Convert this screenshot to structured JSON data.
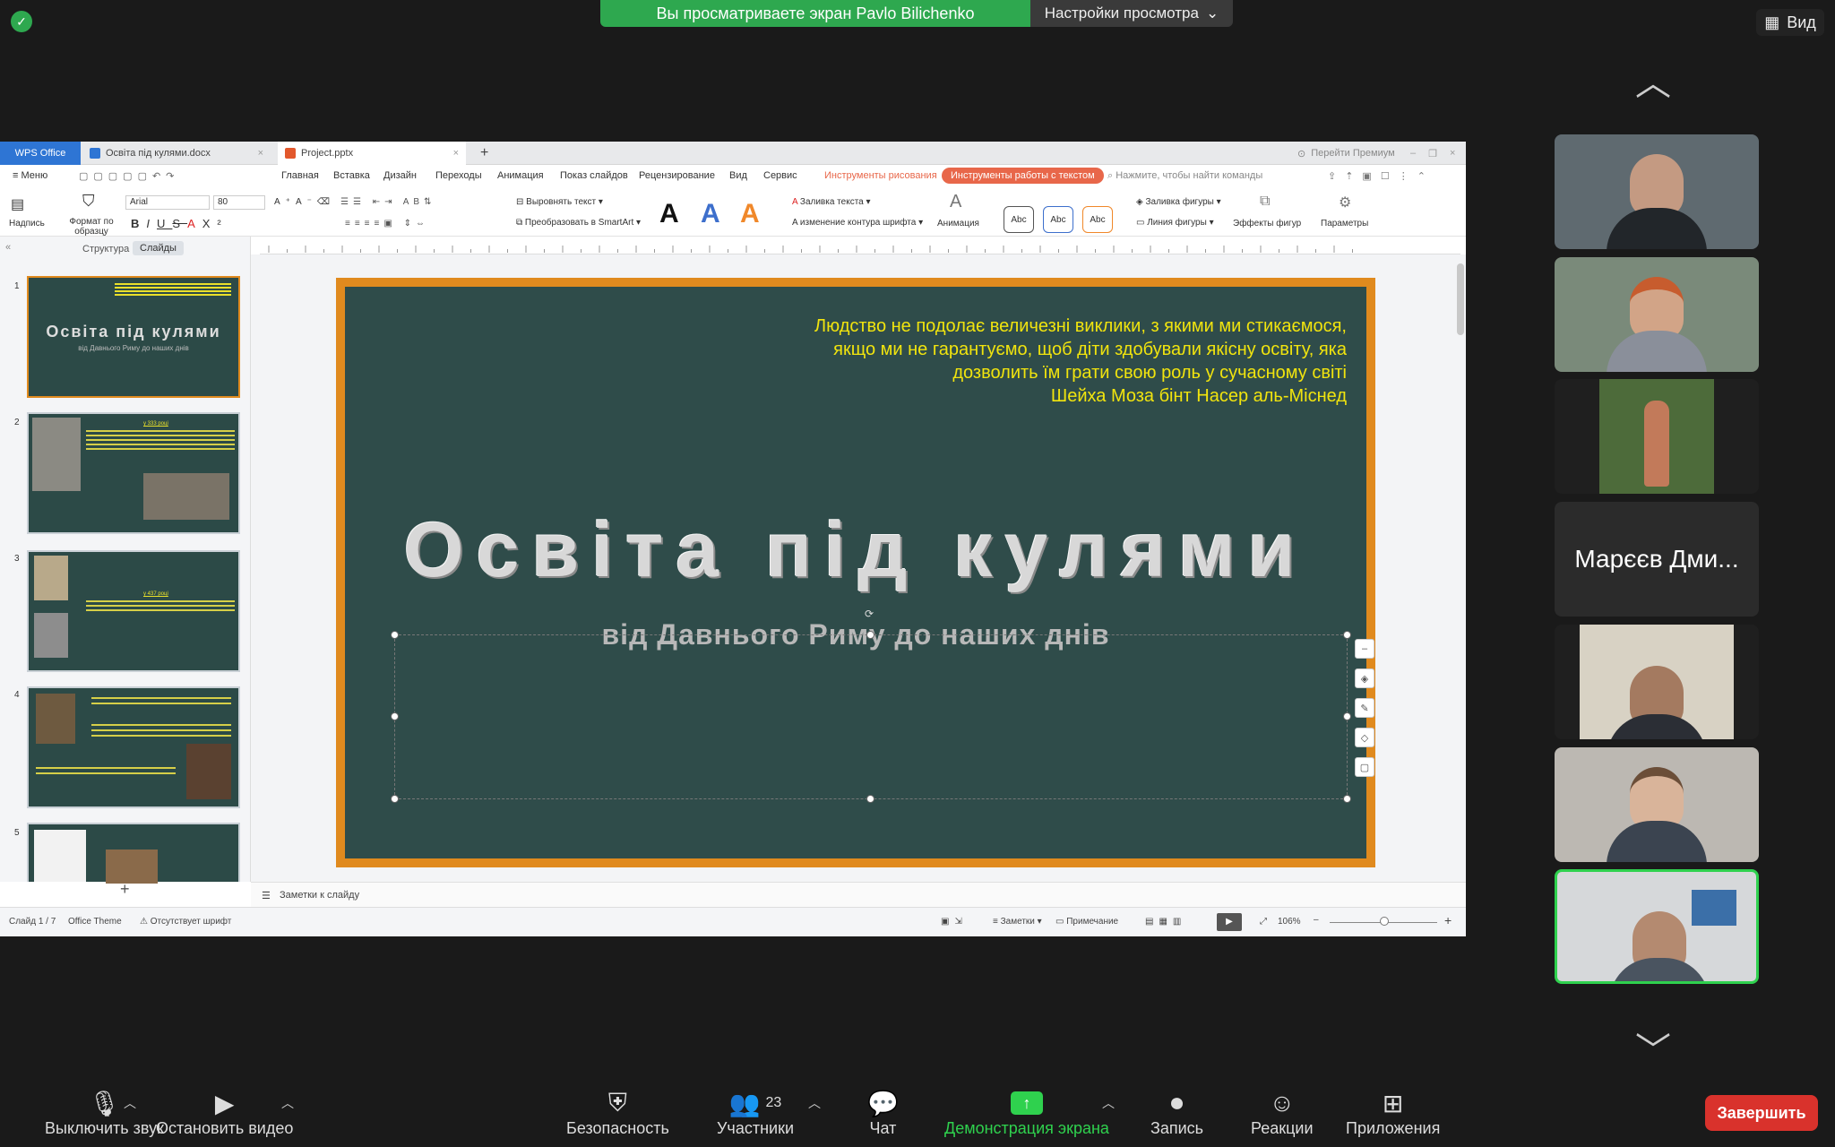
{
  "zoom": {
    "share_banner": "Вы просматриваете экран Pavlo Bilichenko",
    "view_settings": "Настройки просмотра",
    "view_button": "Вид",
    "participant_name": "Марєєв Дми...",
    "participants_count": "23",
    "toolbar": {
      "mute": "Выключить звук",
      "stop_video": "Остановить видео",
      "security": "Безопасность",
      "participants": "Участники",
      "chat": "Чат",
      "share": "Демонстрация экрана",
      "record": "Запись",
      "reactions": "Реакции",
      "apps": "Приложения",
      "end": "Завершить"
    },
    "colors": {
      "share_green": "#2ea84f",
      "end_red": "#d9322c",
      "self_border": "#2fd14e"
    }
  },
  "wps": {
    "tabs": {
      "home": "WPS Office",
      "doc": "Освіта під кулями.docx",
      "pptx": "Project.pptx"
    },
    "premium": "Перейти Премиум",
    "menu": {
      "menu": "Меню",
      "main": "Главная",
      "insert": "Вставка",
      "design": "Дизайн",
      "transitions": "Переходы",
      "animation": "Анимация",
      "slideshow": "Показ слайдов",
      "review": "Рецензирование",
      "view": "Вид",
      "service": "Сервис",
      "drawing_tools": "Инструменты рисования",
      "text_tools": "Инструменты работы с текстом",
      "search_placeholder": "Нажмите, чтобы найти команды"
    },
    "ribbon": {
      "caption": "Надпись",
      "format_painter": "Формат по образцу",
      "font": "Arial",
      "size": "80",
      "align_text": "Выровнять текст",
      "smartart": "Преобразовать в SmartArt",
      "text_fill": "Заливка текста",
      "text_outline": "изменение контура шрифта",
      "animation": "Анимация",
      "abc": "Abc",
      "shape_fill": "Заливка фигуры",
      "shape_line": "Линия фигуры",
      "shape_effects": "Эффекты фигур",
      "params": "Параметры"
    },
    "panel": {
      "structure": "Структура",
      "slides": "Слайды"
    },
    "thumbs": {
      "t1_title": "Освіта під кулями",
      "t1_sub": "від Давнього Риму до наших днів",
      "t2_head": "у 333 році",
      "t3_head": "у 437 році"
    },
    "slide": {
      "quote_lines": [
        "Людство не подолає величезні виклики, з якими ми стикаємося,",
        "якщо ми не гарантуємо, щоб діти здобували якісну освіту, яка",
        "дозволить їм грати свою роль у сучасному світі",
        "Шейха Моза бінт Насер аль-Міснед"
      ],
      "title": "Освіта під кулями",
      "subtitle": "від Давнього Риму до наших днів"
    },
    "notes": "Заметки к слайду",
    "status": {
      "slide": "Слайд 1 / 7",
      "theme": "Office Theme",
      "font_missing": "Отсутствует шрифт",
      "notes": "Заметки",
      "comment": "Примечание",
      "zoom": "106%"
    },
    "colors": {
      "slide_bg": "#2f4c4a",
      "slide_border": "#e08a1e",
      "quote": "#f1e40e",
      "tab_blue": "#2e75d4",
      "text_tools": "#e8674a"
    }
  }
}
